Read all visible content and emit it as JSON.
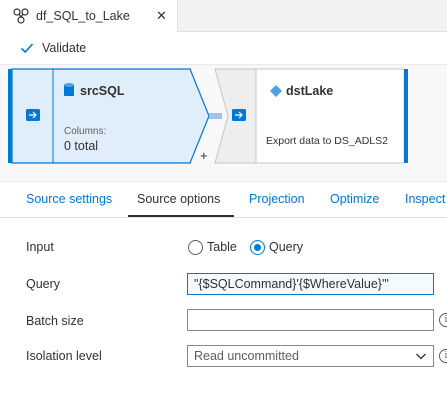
{
  "tab": {
    "title": "df_SQL_to_Lake",
    "icon": "dataflow-icon",
    "close_glyph": "✕"
  },
  "toolbar": {
    "validate_label": "Validate",
    "validate_icon": "checkmark-icon"
  },
  "canvas": {
    "source_node": {
      "name": "srcSQL",
      "columns_label": "Columns:",
      "columns_value": "0 total",
      "icon": "sql-database-icon"
    },
    "sink_node": {
      "name": "dstLake",
      "description": "Export data to DS_ADLS2",
      "icon": "data-lake-icon"
    },
    "add_glyph": "+",
    "colors": {
      "node_selected_fill": "#dfeefa",
      "node_border": "#0078d4",
      "sink_fill": "#ffffff"
    }
  },
  "config": {
    "tabs": [
      "Source settings",
      "Source options",
      "Projection",
      "Optimize",
      "Inspect"
    ],
    "active_tab": "Source options",
    "input": {
      "label": "Input",
      "options": [
        "Table",
        "Query"
      ],
      "selected": "Query"
    },
    "query": {
      "label": "Query",
      "value": "\"{$SQLCommand}'{$WhereValue}'\""
    },
    "batch_size": {
      "label": "Batch size",
      "value": ""
    },
    "isolation_level": {
      "label": "Isolation level",
      "value": "Read uncommitted"
    },
    "info_glyph": "i",
    "colors": {
      "accent": "#0078d4",
      "text": "#323130"
    }
  }
}
